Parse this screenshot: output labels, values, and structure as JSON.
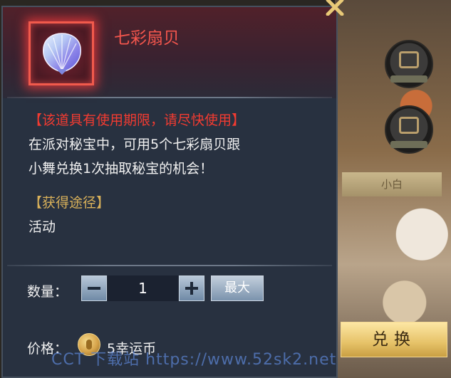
{
  "item": {
    "name": "七彩扇贝",
    "icon": "rainbow-scallop-shell-icon",
    "frame_color": "#f15a4c"
  },
  "description": {
    "warning": "【该道具有使用期限，请尽快使用】",
    "text_line1": "在派对秘宝中，可用5个七彩扇贝跟",
    "text_line2": "小舞兑换1次抽取秘宝的机会！"
  },
  "source": {
    "heading": "【获得途径】",
    "value": "活动"
  },
  "quantity": {
    "label": "数量：",
    "value": "1",
    "max_label": "最大"
  },
  "price": {
    "label": "价格：",
    "value": "5幸运币",
    "currency_icon": "lucky-coin-icon"
  },
  "actions": {
    "exchange_label": "兑换"
  },
  "background": {
    "tab_label": "小白"
  },
  "watermark": "CCT 下载站 https://www.52sk2.net",
  "colors": {
    "warning": "#f23b31",
    "heading": "#d9b15a",
    "item_name": "#f4564d",
    "exchange_button": "#e6c268"
  }
}
